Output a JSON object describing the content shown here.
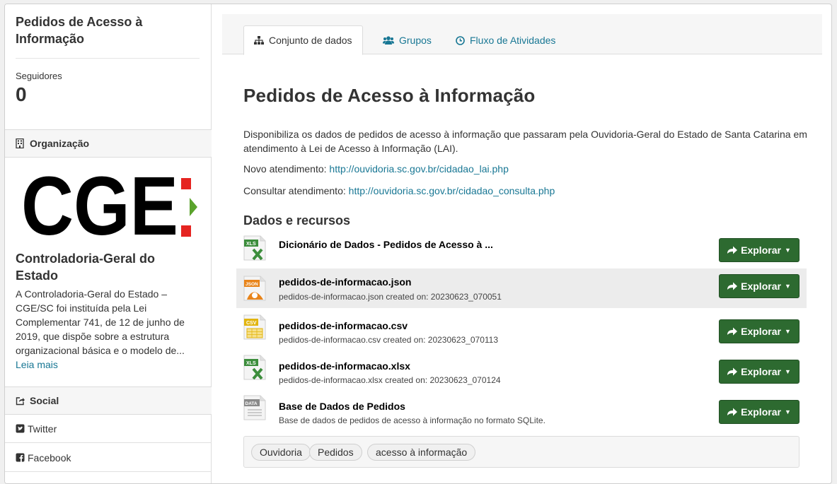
{
  "sidebar": {
    "title": "Pedidos de Acesso à Informação",
    "followers_label": "Seguidores",
    "followers_count": "0",
    "org_heading": "Organização",
    "org_logo_text": "CGE",
    "org_name": "Controladoria-Geral do Estado",
    "org_description": "A Controladoria-Geral do Estado – CGE/SC foi instituída pela Lei Complementar 741, de 12 de junho de 2019, que dispõe sobre a estrutura organizacional básica e o modelo de...",
    "read_more": "Leia mais",
    "social_heading": "Social",
    "social_items": [
      {
        "label": "Twitter",
        "icon": "twitter-icon"
      },
      {
        "label": "Facebook",
        "icon": "facebook-icon"
      }
    ]
  },
  "tabs": [
    {
      "label": "Conjunto de dados",
      "icon": "sitemap-icon",
      "active": true
    },
    {
      "label": "Grupos",
      "icon": "users-icon",
      "active": false
    },
    {
      "label": "Fluxo de Atividades",
      "icon": "clock-icon",
      "active": false
    }
  ],
  "main": {
    "title": "Pedidos de Acesso à Informação",
    "description": "Disponibiliza os dados de pedidos de acesso à informação que passaram pela Ouvidoria-Geral do Estado de Santa Catarina em atendimento à Lei de Acesso à Informação (LAI).",
    "new_service_label": "Novo atendimento:",
    "new_service_link": "http://ouvidoria.sc.gov.br/cidadao_lai.php",
    "consult_label": "Consultar atendimento:",
    "consult_link": "http://ouvidoria.sc.gov.br/cidadao_consulta.php",
    "resources_heading": "Dados e recursos",
    "explore_label": "Explorar",
    "resources": [
      {
        "title": "Dicionário de Dados - Pedidos de Acesso à ...",
        "subtitle": "",
        "format": "XLS",
        "color": "#3c8d3c"
      },
      {
        "title": "pedidos-de-informacao.json",
        "subtitle": "pedidos-de-informacao.json created on: 20230623_070051",
        "format": "JSON",
        "color": "#e8841a"
      },
      {
        "title": "pedidos-de-informacao.csv",
        "subtitle": "pedidos-de-informacao.csv created on: 20230623_070113",
        "format": "CSV",
        "color": "#e2b50f"
      },
      {
        "title": "pedidos-de-informacao.xlsx",
        "subtitle": "pedidos-de-informacao.xlsx created on: 20230623_070124",
        "format": "XLS",
        "color": "#3c8d3c"
      },
      {
        "title": "Base de Dados de Pedidos",
        "subtitle": "Base de dados de pedidos de acesso à informação no formato SQLite.",
        "format": "DATA",
        "color": "#8a8a8a"
      }
    ],
    "tags": [
      "Ouvidoria",
      "Pedidos",
      "acesso à informação"
    ]
  },
  "colors": {
    "link": "#187794",
    "button": "#2d6a30",
    "logo_red": "#e52421",
    "logo_green": "#5aa32c"
  }
}
